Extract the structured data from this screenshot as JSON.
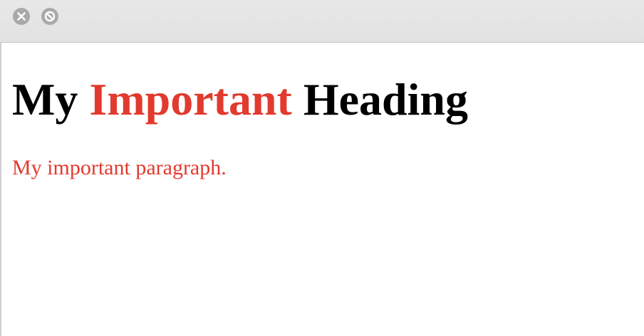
{
  "window": {
    "controls": [
      {
        "name": "close",
        "icon": "close-x-icon"
      },
      {
        "name": "blocked",
        "icon": "block-icon"
      }
    ]
  },
  "page": {
    "heading": {
      "part1": "My ",
      "part2": "Important",
      "part3": " Heading"
    },
    "paragraph": "My important paragraph."
  },
  "colors": {
    "accent": "#e23a2e",
    "text": "#000000",
    "titlebar": "#e4e4e4",
    "control": "#a9a9a9"
  }
}
